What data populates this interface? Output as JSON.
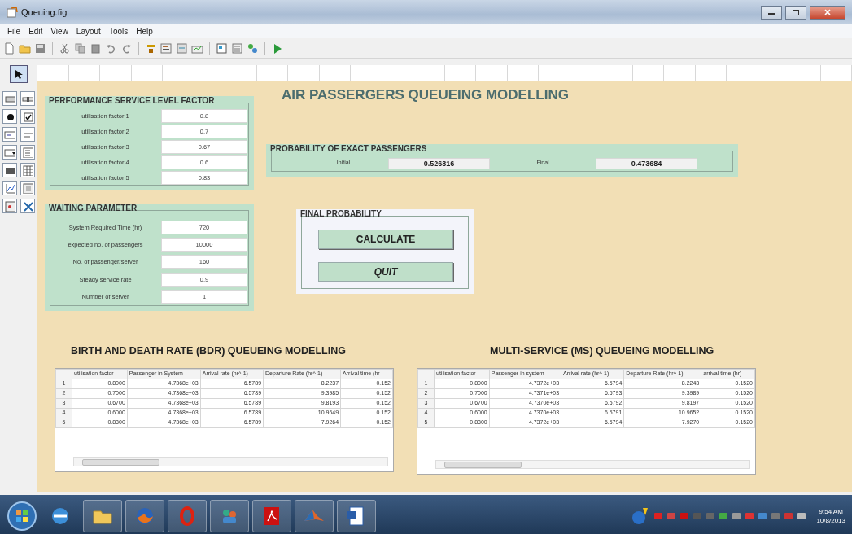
{
  "window": {
    "title": "Queuing.fig"
  },
  "menu": [
    "File",
    "Edit",
    "View",
    "Layout",
    "Tools",
    "Help"
  ],
  "heading": "AIR PASSERGERS QUEUEING MODELLING",
  "performance_panel": {
    "title": "PERFORMANCE SERVICE LEVEL FACTOR",
    "fields": [
      {
        "label": "utilisation factor 1",
        "value": "0.8"
      },
      {
        "label": "utilisation factor 2",
        "value": "0.7"
      },
      {
        "label": "utilisation factor 3",
        "value": "0.67"
      },
      {
        "label": "utilisation factor 4",
        "value": "0.6"
      },
      {
        "label": "utilisation factor 5",
        "value": "0.83"
      }
    ]
  },
  "waiting_panel": {
    "title": "WAITING PARAMETER",
    "fields": [
      {
        "label": "System Required Time  (hr)",
        "value": "720"
      },
      {
        "label": "expected no. of passengers",
        "value": "10000"
      },
      {
        "label": "No. of passenger/server",
        "value": "160"
      },
      {
        "label": "Steady service rate",
        "value": "0.9"
      },
      {
        "label": "Number of server",
        "value": "1"
      }
    ]
  },
  "probability_panel": {
    "title": "PROBABILITY OF EXACT PASSENGERS",
    "fields": [
      {
        "label": "Initial",
        "value": "0.526316"
      },
      {
        "label": "Final",
        "value": "0.473684"
      }
    ]
  },
  "final_panel": {
    "title": "FINAL PROBABILITY",
    "buttons": [
      {
        "label": "CALCULATE",
        "italic": false
      },
      {
        "label": "QUIT",
        "italic": true
      }
    ]
  },
  "tables": [
    {
      "title": "BIRTH AND DEATH RATE (BDR) QUEUEING MODELLING",
      "columns": [
        "",
        "utilisation factor",
        "Passenger in System",
        "Arrival rate (hr^-1)",
        "Departure Rate (hr^-1)",
        "Arrival time (hr"
      ],
      "rows": [
        [
          "1",
          "0.8000",
          "4.7368e+03",
          "6.5789",
          "8.2237",
          "0.152"
        ],
        [
          "2",
          "0.7000",
          "4.7368e+03",
          "6.5789",
          "9.3985",
          "0.152"
        ],
        [
          "3",
          "0.6700",
          "4.7368e+03",
          "6.5789",
          "9.8193",
          "0.152"
        ],
        [
          "4",
          "0.6000",
          "4.7368e+03",
          "6.5789",
          "10.9649",
          "0.152"
        ],
        [
          "5",
          "0.8300",
          "4.7368e+03",
          "6.5789",
          "7.9264",
          "0.152"
        ]
      ]
    },
    {
      "title": "MULTI-SERVICE (MS) QUEUEING MODELLING",
      "columns": [
        "",
        "utilisation factor",
        "Passenger in system",
        "Arrival rate (hr^-1)",
        "Departure Rate (hr^-1)",
        "arrival time (hr)"
      ],
      "rows": [
        [
          "1",
          "0.8000",
          "4.7372e+03",
          "6.5794",
          "8.2243",
          "0.1520"
        ],
        [
          "2",
          "0.7000",
          "4.7371e+03",
          "6.5793",
          "9.3989",
          "0.1520"
        ],
        [
          "3",
          "0.6700",
          "4.7370e+03",
          "6.5792",
          "9.8197",
          "0.1520"
        ],
        [
          "4",
          "0.6000",
          "4.7370e+03",
          "6.5791",
          "10.9652",
          "0.1520"
        ],
        [
          "5",
          "0.8300",
          "4.7372e+03",
          "6.5794",
          "7.9270",
          "0.1520"
        ]
      ]
    }
  ],
  "taskbar": {
    "time": "9:54 AM",
    "date": "10/8/2013"
  }
}
